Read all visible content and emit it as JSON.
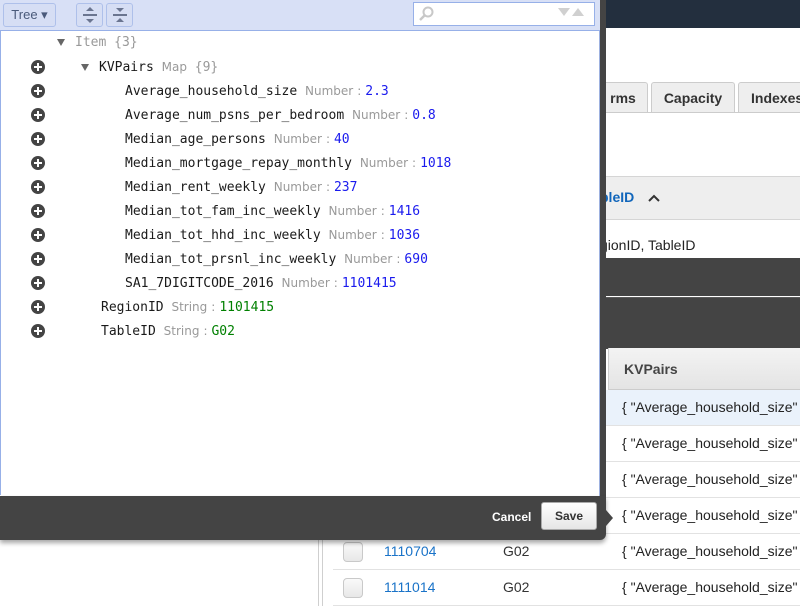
{
  "background": {
    "tabs": [
      {
        "label": "rms"
      },
      {
        "label": "Capacity"
      },
      {
        "label": "Indexes"
      }
    ],
    "sort": {
      "label": "bleID",
      "direction_icon": "chevron-up-icon"
    },
    "keys_text": "gionID, TableID",
    "table": {
      "kv_header": "KVPairs",
      "rows": [
        {
          "region": "",
          "table": "",
          "kv": "{ \"Average_household_size\"",
          "selected": true
        },
        {
          "region": "",
          "table": "",
          "kv": "{ \"Average_household_size\""
        },
        {
          "region": "",
          "table": "",
          "kv": "{ \"Average_household_size\""
        },
        {
          "region": "",
          "table": "",
          "kv": "{ \"Average_household_size\""
        },
        {
          "region": "1110704",
          "table": "G02",
          "kv": "{ \"Average_household_size\""
        },
        {
          "region": "1111014",
          "table": "G02",
          "kv": "{ \"Average_household_size\""
        }
      ]
    }
  },
  "editor": {
    "toolbar": {
      "mode_label": "Tree ▾",
      "expand_all_icon": "expand-all-icon",
      "collapse_all_icon": "collapse-all-icon",
      "search_placeholder": ""
    },
    "tree": {
      "root": {
        "key": "Item",
        "count": "{3}"
      },
      "map": {
        "key": "KVPairs",
        "type": "Map",
        "count": "{9}"
      },
      "entries": [
        {
          "key": "Average_household_size",
          "type": "Number",
          "value": "2.3"
        },
        {
          "key": "Average_num_psns_per_bedroom",
          "type": "Number",
          "value": "0.8"
        },
        {
          "key": "Median_age_persons",
          "type": "Number",
          "value": "40"
        },
        {
          "key": "Median_mortgage_repay_monthly",
          "type": "Number",
          "value": "1018"
        },
        {
          "key": "Median_rent_weekly",
          "type": "Number",
          "value": "237"
        },
        {
          "key": "Median_tot_fam_inc_weekly",
          "type": "Number",
          "value": "1416"
        },
        {
          "key": "Median_tot_hhd_inc_weekly",
          "type": "Number",
          "value": "1036"
        },
        {
          "key": "Median_tot_prsnl_inc_weekly",
          "type": "Number",
          "value": "690"
        },
        {
          "key": "SA1_7DIGITCODE_2016",
          "type": "Number",
          "value": "1101415"
        }
      ],
      "attributes": [
        {
          "key": "RegionID",
          "type": "String",
          "value": "1101415"
        },
        {
          "key": "TableID",
          "type": "String",
          "value": "G02"
        }
      ],
      "separator": ":"
    },
    "footer": {
      "cancel_label": "Cancel",
      "save_label": "Save"
    }
  },
  "colors": {
    "number_value": "#1a1aee",
    "string_value": "#008000",
    "toolbar_bg": "#d8e0f6",
    "footer_bg": "#444444",
    "link": "#1a73c8"
  }
}
